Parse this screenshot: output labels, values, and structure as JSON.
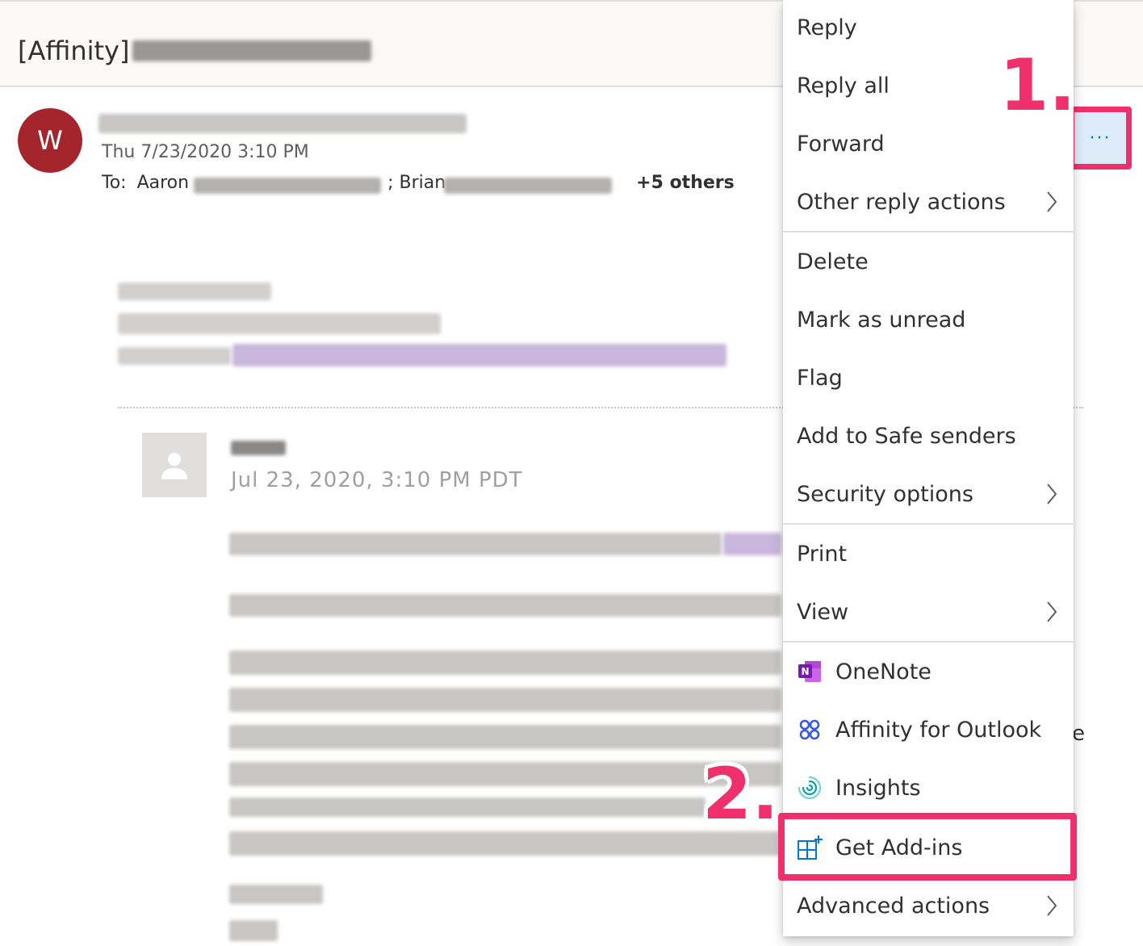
{
  "email": {
    "subject_prefix": "[Affinity]",
    "sender_initial": "W",
    "sent_date": "Thu 7/23/2020 3:10 PM",
    "to_label": "To:",
    "recipient_1": "Aaron",
    "recipient_separator": "; Brian",
    "others_label": "+5 others",
    "quoted_date": "Jul 23, 2020, 3:10 PM PDT",
    "partial_text": "e"
  },
  "more_button": {
    "label": "···",
    "icon": "more-dots-icon"
  },
  "menu": {
    "items": [
      {
        "label": "Reply"
      },
      {
        "label": "Reply all"
      },
      {
        "label": "Forward"
      },
      {
        "label": "Other reply actions",
        "submenu": true
      },
      {
        "label": "Delete"
      },
      {
        "label": "Mark as unread"
      },
      {
        "label": "Flag"
      },
      {
        "label": "Add to Safe senders"
      },
      {
        "label": "Security options",
        "submenu": true
      },
      {
        "label": "Print"
      },
      {
        "label": "View",
        "submenu": true
      },
      {
        "label": "OneNote",
        "icon": "onenote-icon"
      },
      {
        "label": "Affinity for Outlook",
        "icon": "affinity-icon"
      },
      {
        "label": "Insights",
        "icon": "insights-icon"
      },
      {
        "label": "Get Add-ins",
        "icon": "add-ins-icon"
      },
      {
        "label": "Advanced actions",
        "submenu": true
      }
    ]
  },
  "annotations": {
    "step_1": "1.",
    "step_2": "2."
  },
  "colors": {
    "accent": "#f0306c",
    "avatar": "#a4262c",
    "onenote": "#7719aa",
    "affinity": "#3b5bdb",
    "insights": "#00a2ad",
    "addins": "#0078d4"
  }
}
